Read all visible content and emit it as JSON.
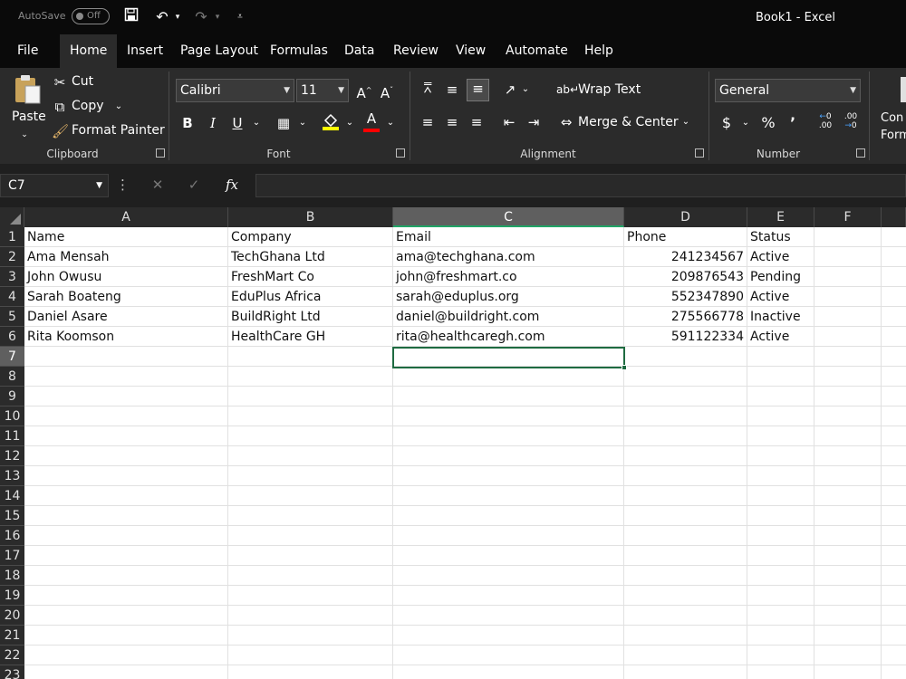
{
  "titlebar": {
    "autosave_label": "AutoSave",
    "autosave_state": "Off",
    "document_title": "Book1  -  Excel"
  },
  "tabs": [
    "File",
    "Home",
    "Insert",
    "Page Layout",
    "Formulas",
    "Data",
    "Review",
    "View",
    "Automate",
    "Help"
  ],
  "active_tab": "Home",
  "ribbon": {
    "clipboard": {
      "label": "Clipboard",
      "paste": "Paste",
      "cut": "Cut",
      "copy": "Copy",
      "format_painter": "Format Painter"
    },
    "font": {
      "label": "Font",
      "family": "Calibri",
      "size": "11",
      "bold": "B",
      "italic": "I",
      "underline": "U",
      "font_color": "A"
    },
    "alignment": {
      "label": "Alignment",
      "wrap_text": "Wrap Text",
      "merge_center": "Merge & Center"
    },
    "number": {
      "label": "Number",
      "format": "General",
      "currency": "$",
      "percent": "%",
      "comma": "’",
      "inc_decimal": "←0 .00",
      "dec_decimal": ".00 →0"
    },
    "styles": {
      "conditional_formatting": "Con Form"
    },
    "accent_color": "#21a366",
    "highlight_color": "#ffff00",
    "font_color_bar": "#ff0000"
  },
  "formula_bar": {
    "name_box": "C7",
    "fx": "fx",
    "value": ""
  },
  "sheet": {
    "columns": [
      "A",
      "B",
      "C",
      "D",
      "E",
      "F"
    ],
    "selected_column": "C",
    "selected_row": "7",
    "row_numbers": [
      "1",
      "2",
      "3",
      "4",
      "5",
      "6",
      "7",
      "8",
      "9",
      "10",
      "11",
      "12",
      "13",
      "14",
      "15",
      "16",
      "17",
      "18",
      "19",
      "20",
      "21",
      "22",
      "23"
    ],
    "header": [
      "Name",
      "Company",
      "Email",
      "Phone",
      "Status"
    ],
    "rows": [
      [
        "Ama Mensah",
        "TechGhana Ltd",
        "ama@techghana.com",
        "241234567",
        "Active"
      ],
      [
        "John Owusu",
        "FreshMart Co",
        "john@freshmart.co",
        "209876543",
        "Pending"
      ],
      [
        "Sarah Boateng",
        "EduPlus Africa",
        "sarah@eduplus.org",
        "552347890",
        "Active"
      ],
      [
        "Daniel Asare",
        "BuildRight Ltd",
        "daniel@buildright.com",
        "275566778",
        "Inactive"
      ],
      [
        "Rita Koomson",
        "HealthCare GH",
        "rita@healthcaregh.com",
        "591122334",
        "Active"
      ]
    ],
    "active_cell": "C7"
  }
}
